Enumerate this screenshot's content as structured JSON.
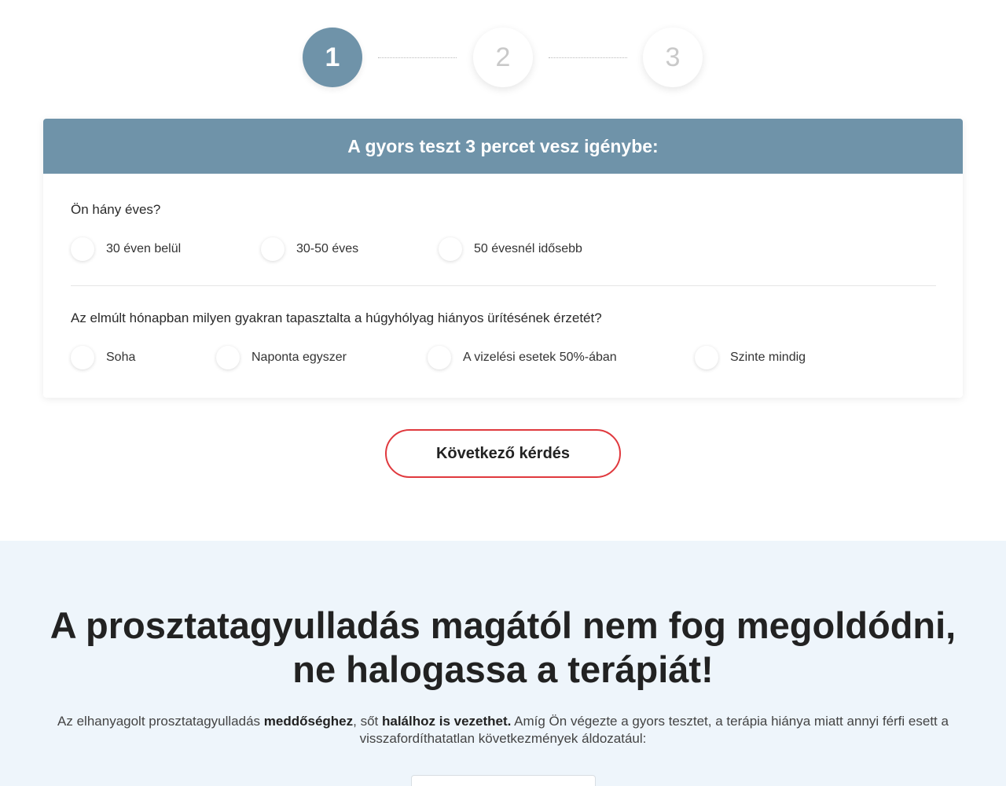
{
  "stepper": {
    "steps": [
      {
        "label": "1",
        "active": true
      },
      {
        "label": "2",
        "active": false
      },
      {
        "label": "3",
        "active": false
      }
    ]
  },
  "quiz": {
    "header": "A gyors teszt 3 percet vesz igénybe:",
    "questions": [
      {
        "text": "Ön hány éves?",
        "options": [
          "30 éven belül",
          "30-50 éves",
          "50 évesnél idősebb"
        ]
      },
      {
        "text": "Az elmúlt hónapban milyen gyakran tapasztalta a húgyhólyag hiányos ürítésének érzetét?",
        "options": [
          "Soha",
          "Naponta egyszer",
          "A vizelési esetek 50%-ában",
          "Szinte mindig"
        ]
      }
    ],
    "next_label": "Következő kérdés"
  },
  "info": {
    "title_line1": "A prosztatagyulladás magától nem fog megoldódni,",
    "title_line2": "ne halogassa a terápiát!",
    "text_part1": "Az elhanyagolt prosztatagyulladás ",
    "text_bold1": "meddőséghez",
    "text_part2": ", sőt ",
    "text_bold2": "halálhoz is vezethet.",
    "text_part3": " Amíg Ön végezte a gyors tesztet, a terápia hiánya miatt annyi férfi esett a visszafordíthatatlan következmények áldozatául:"
  },
  "colors": {
    "accent": "#6f93a9",
    "button_border": "#e0393e",
    "info_bg": "#eef5fb"
  }
}
